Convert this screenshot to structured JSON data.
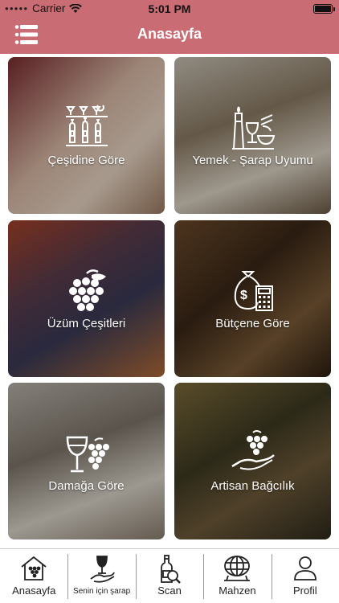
{
  "status_bar": {
    "carrier": "Carrier",
    "time": "5:01 PM"
  },
  "nav": {
    "title": "Anasayfa",
    "menu_icon": "menu-icon"
  },
  "tiles": [
    {
      "label": "Çeşidine Göre",
      "icon": "wine-bottles-icon"
    },
    {
      "label": "Yemek - Şarap Uyumu",
      "icon": "food-wine-pairing-icon"
    },
    {
      "label": "Üzüm Çeşitleri",
      "icon": "grapes-icon"
    },
    {
      "label": "Bütçene Göre",
      "icon": "money-bag-icon"
    },
    {
      "label": "Damağa Göre",
      "icon": "wine-glass-grapes-icon"
    },
    {
      "label": "Artisan Bağcılık",
      "icon": "hand-grapes-icon"
    }
  ],
  "tabbar": [
    {
      "label": "Anasayfa",
      "icon": "home-grapes-icon"
    },
    {
      "label": "Senin için şarap",
      "icon": "hand-wine-icon"
    },
    {
      "label": "Scan",
      "icon": "scan-bottle-icon"
    },
    {
      "label": "Mahzen",
      "icon": "barrel-icon"
    },
    {
      "label": "Profil",
      "icon": "person-icon"
    }
  ]
}
